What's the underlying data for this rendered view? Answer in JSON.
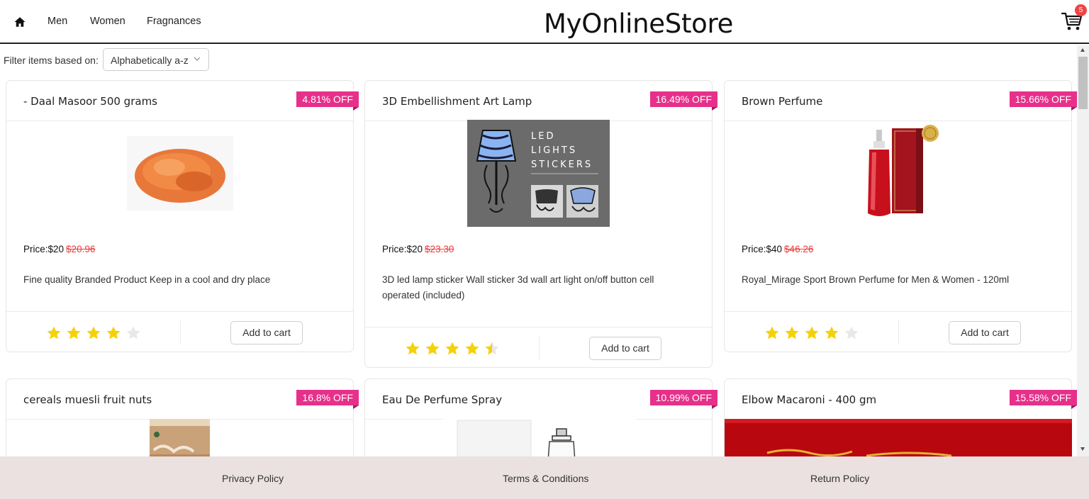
{
  "header": {
    "nav": [
      "Men",
      "Women",
      "Fragnances"
    ],
    "brand": "MyOnlineStore",
    "cart_count": "5"
  },
  "filter": {
    "label": "Filter items based on:",
    "selected": "Alphabetically a-z"
  },
  "colors": {
    "badge": "#e6308a",
    "star": "#f5d10a",
    "star_empty": "#e5e5e5",
    "old_price": "#e53e3e",
    "footer_bg": "#ebe1e1"
  },
  "products": [
    {
      "title": "- Daal Masoor 500 grams",
      "discount": "4.81% OFF",
      "price_label": "Price:$20",
      "old_price": "$20.96",
      "description": "Fine quality Branded Product Keep in a cool and dry place",
      "rating": 4,
      "add_label": "Add to cart",
      "image": "orange-lentils-photo"
    },
    {
      "title": "3D Embellishment Art Lamp",
      "discount": "16.49% OFF",
      "price_label": "Price:$20",
      "old_price": "$23.30",
      "description": "3D led lamp sticker Wall sticker 3d wall art light on/off button cell operated (included)",
      "rating": 4.5,
      "add_label": "Add to cart",
      "image": "led-lamp-sticker-photo",
      "image_text": [
        "LED",
        "LIGHTS",
        "STICKERS"
      ]
    },
    {
      "title": "Brown Perfume",
      "discount": "15.66% OFF",
      "price_label": "Price:$40",
      "old_price": "$46.26",
      "description": "Royal_Mirage Sport Brown Perfume for Men & Women - 120ml",
      "rating": 4,
      "add_label": "Add to cart",
      "image": "red-perfume-bottle-photo"
    },
    {
      "title": "cereals muesli fruit nuts",
      "discount": "16.8% OFF",
      "image": "muesli-pack-photo"
    },
    {
      "title": "Eau De Perfume Spray",
      "discount": "10.99% OFF",
      "image": "perfume-spray-photo"
    },
    {
      "title": "Elbow Macaroni - 400 gm",
      "discount": "15.58% OFF",
      "image": "macaroni-pack-photo"
    }
  ],
  "footer": {
    "links": [
      "Privacy Policy",
      "Terms & Conditions",
      "Return Policy"
    ]
  }
}
